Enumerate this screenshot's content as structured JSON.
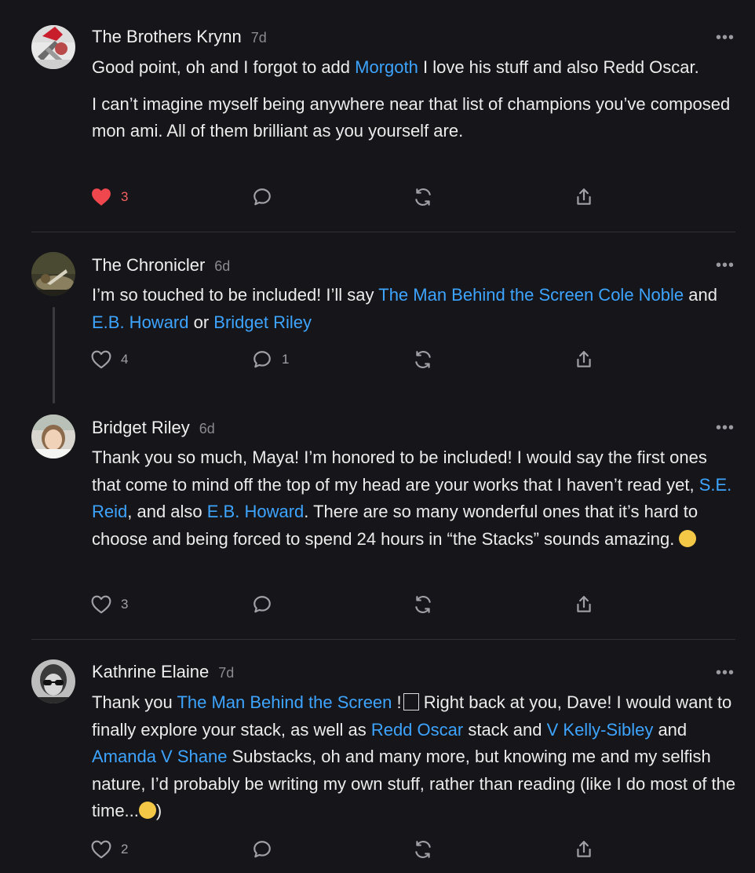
{
  "comments": [
    {
      "author": "The Brothers Krynn",
      "time": "7d",
      "body": [
        [
          {
            "t": "Good point, oh and I forgot to add "
          },
          {
            "t": "Morgoth",
            "link": true
          },
          {
            "t": " I love his stuff and also Redd Oscar."
          }
        ],
        [
          {
            "t": "I can’t imagine myself being anywhere near that list of champions you’ve composed mon ami. All of them brilliant as you yourself are."
          }
        ]
      ],
      "likes": "3",
      "liked": true,
      "replies": ""
    },
    {
      "author": "The Chronicler",
      "time": "6d",
      "body": [
        [
          {
            "t": "I’m so touched to be included! I’ll say "
          },
          {
            "t": "The Man Behind the Screen Cole Noble",
            "link": true
          },
          {
            "t": " and "
          },
          {
            "t": "E.B. Howard",
            "link": true
          },
          {
            "t": " or "
          },
          {
            "t": "Bridget Riley",
            "link": true
          }
        ]
      ],
      "likes": "4",
      "liked": false,
      "replies": "1"
    },
    {
      "author": "Bridget Riley",
      "time": "6d",
      "body": [
        [
          {
            "t": "Thank you so much, Maya! I’m honored to be included! I would say the first ones that come to mind off the top of my head are your works that I haven’t read yet, "
          },
          {
            "t": "S.E. Reid",
            "link": true
          },
          {
            "t": ", and also "
          },
          {
            "t": "E.B. Howard",
            "link": true
          },
          {
            "t": ". There are so many wonderful ones that it’s hard to choose and being forced to spend 24 hours in “the Stacks” sounds amazing. "
          },
          {
            "emoji": "laughing-emoji"
          }
        ]
      ],
      "likes": "3",
      "liked": false,
      "replies": ""
    },
    {
      "author": "Kathrine Elaine",
      "time": "7d",
      "body": [
        [
          {
            "t": "Thank you "
          },
          {
            "t": "The Man Behind the Screen",
            "link": true
          },
          {
            "t": " !"
          },
          {
            "emoji": "missing-glyph"
          },
          {
            "t": " Right back at you, Dave! I would want to finally explore your stack, as well as "
          },
          {
            "t": "Redd Oscar",
            "link": true
          },
          {
            "t": " stack and "
          },
          {
            "t": "V Kelly-Sibley",
            "link": true
          },
          {
            "t": " and "
          },
          {
            "t": "Amanda V Shane",
            "link": true
          },
          {
            "t": " Substacks, oh and many more, but knowing me and my selfish nature, I’d probably be writing my own stuff, rather than reading (like I do most of the time..."
          },
          {
            "emoji": "eye-roll-emoji"
          },
          {
            "t": ")"
          }
        ]
      ],
      "likes": "2",
      "liked": false,
      "replies": ""
    }
  ],
  "icons": {
    "like": "heart-icon",
    "reply": "speech-bubble-icon",
    "restack": "restack-arrows-icon",
    "share": "share-upload-icon",
    "more": "more-dots-icon"
  },
  "colors": {
    "background": "#16161a",
    "link": "#3da4ff",
    "liked_heart": "#f0474e",
    "liked_count": "#f26161"
  }
}
